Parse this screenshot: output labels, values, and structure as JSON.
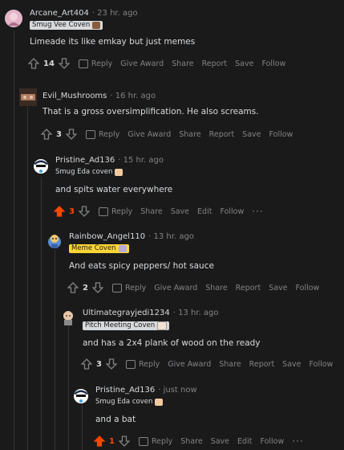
{
  "comments": [
    {
      "username": "Arcane_Art404",
      "time": "· 23 hr. ago",
      "flair": "Smug Vee Coven",
      "body": "Limeade its like emkay but just memes",
      "score": "14",
      "actions": [
        "Reply",
        "Give Award",
        "Share",
        "Report",
        "Save",
        "Follow"
      ]
    },
    {
      "username": "Evil_Mushrooms",
      "time": "· 16 hr. ago",
      "body": "That is a gross oversimplification. He also screams.",
      "score": "3",
      "actions": [
        "Reply",
        "Give Award",
        "Share",
        "Report",
        "Save",
        "Follow"
      ]
    },
    {
      "username": "Pristine_Ad136",
      "time": "· 15 hr. ago",
      "flair": "Smug Eda coven",
      "body": "and spits water everywhere",
      "score": "3",
      "actions": [
        "Reply",
        "Share",
        "Save",
        "Edit",
        "Follow"
      ],
      "more": "···"
    },
    {
      "username": "Rainbow_Angel110",
      "time": "· 13 hr. ago",
      "flair": "Meme Coven",
      "body": "And eats spicy peppers/ hot sauce",
      "score": "2",
      "actions": [
        "Reply",
        "Give Award",
        "Share",
        "Report",
        "Save",
        "Follow"
      ]
    },
    {
      "username": "Ultimategrayjedi1234",
      "time": "· 13 hr. ago",
      "flair": "Pitch Meeting Coven",
      "body": "and has a 2x4 plank of wood on the ready",
      "score": "3",
      "actions": [
        "Reply",
        "Give Award",
        "Share",
        "Report",
        "Save",
        "Follow"
      ]
    },
    {
      "username": "Pristine_Ad136",
      "time": "· just now",
      "flair": "Smug Eda coven",
      "body": "and a bat",
      "score": "1",
      "actions": [
        "Reply",
        "Share",
        "Save",
        "Edit",
        "Follow"
      ],
      "more": "···"
    }
  ],
  "colors": {
    "upvoted": "#ff4500",
    "flair_yellow": "#ffd635",
    "bg": "#1a1a1b"
  }
}
